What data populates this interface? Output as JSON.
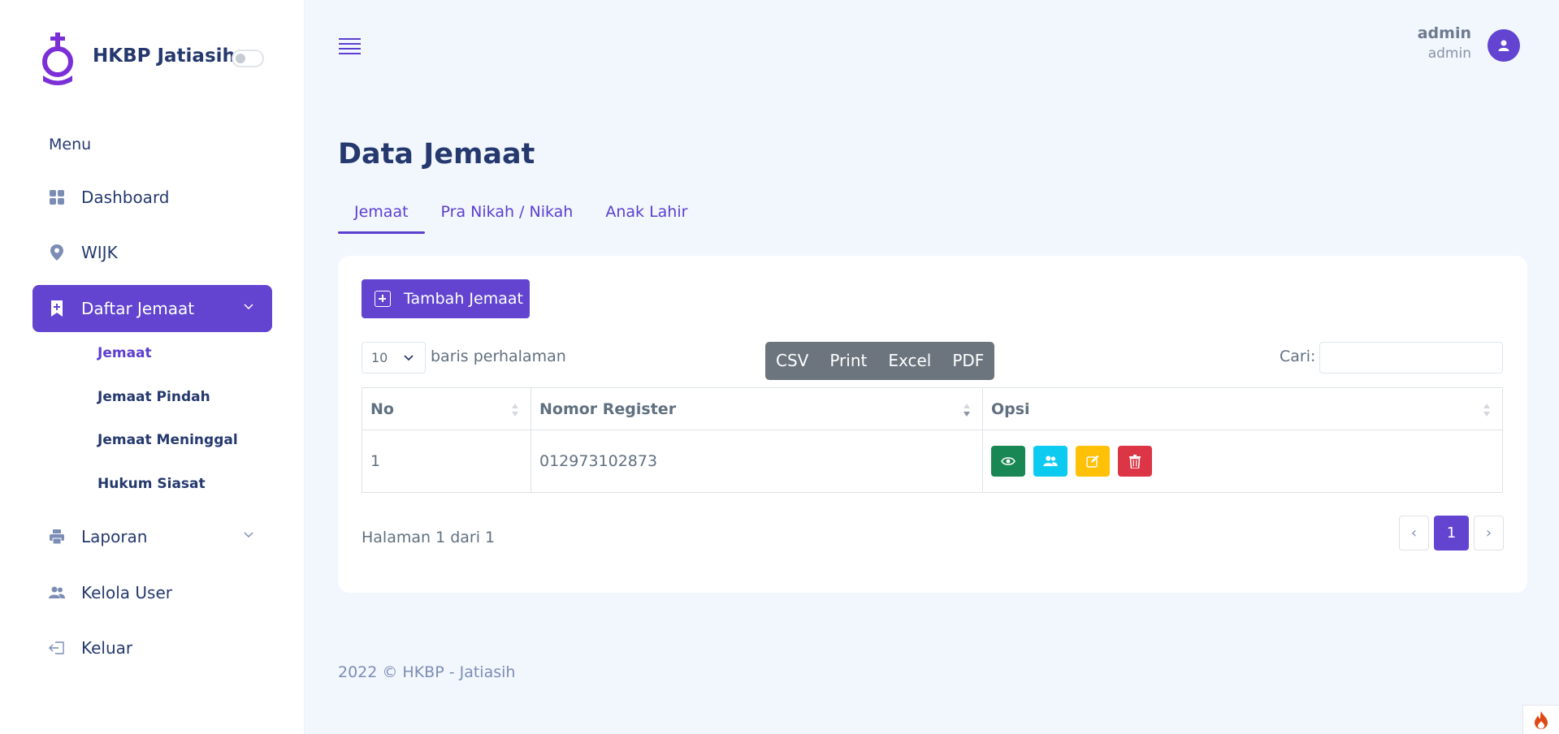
{
  "brand": {
    "name": "HKBP Jatiasih"
  },
  "sidebar": {
    "menu_title": "Menu",
    "items": [
      {
        "label": "Dashboard",
        "icon": "grid-icon"
      },
      {
        "label": "WIJK",
        "icon": "map-pin-icon"
      },
      {
        "label": "Daftar Jemaat",
        "icon": "bookmark-plus-icon",
        "active": true
      },
      {
        "label": "Laporan",
        "icon": "printer-icon"
      },
      {
        "label": "Kelola User",
        "icon": "people-icon"
      },
      {
        "label": "Keluar",
        "icon": "logout-icon"
      }
    ],
    "sub_items": [
      "Jemaat",
      "Jemaat Pindah",
      "Jemaat Meninggal",
      "Hukum Siasat"
    ]
  },
  "header": {
    "user_name": "admin",
    "user_role": "admin"
  },
  "page": {
    "title": "Data Jemaat",
    "tabs": [
      "Jemaat",
      "Pra Nikah / Nikah",
      "Anak Lahir"
    ]
  },
  "card": {
    "add_button": "Tambah Jemaat",
    "page_length": "10",
    "length_label": "baris perhalaman",
    "export_buttons": [
      "CSV",
      "Print",
      "Excel",
      "PDF"
    ],
    "search_label": "Cari:",
    "columns": [
      "No",
      "Nomor Register",
      "Opsi"
    ],
    "rows": [
      {
        "no": "1",
        "nomor_register": "012973102873"
      }
    ],
    "page_info": "Halaman 1 dari 1",
    "pagination": {
      "prev": "‹",
      "current": "1",
      "next": "›"
    }
  },
  "footer": {
    "text": "2022 © HKBP - Jatiasih"
  },
  "colors": {
    "primary": "#6244d1",
    "view": "#198754",
    "family": "#0dcaf0",
    "edit": "#ffc107",
    "delete": "#dc3545"
  }
}
